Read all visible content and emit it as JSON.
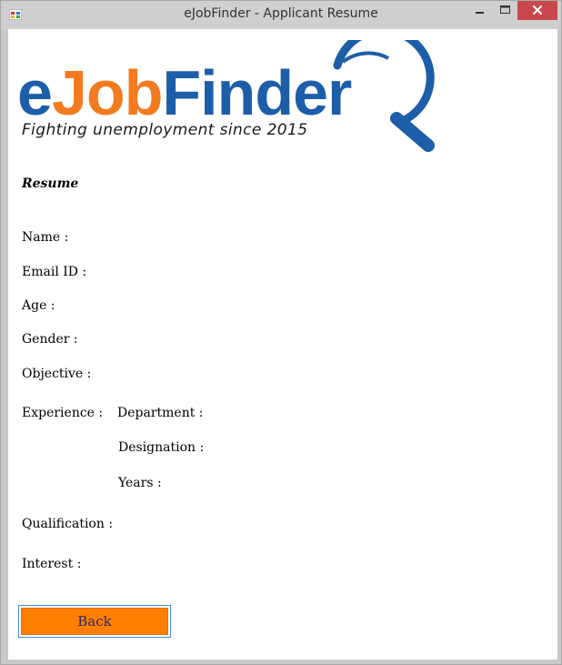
{
  "window": {
    "title": "eJobFinder - Applicant Resume"
  },
  "brand": {
    "logo_prefix": "e",
    "logo_mid": "Job",
    "logo_suffix": "Finder",
    "tagline": "Fighting unemployment since 2015",
    "color_blue": "#1d5ea8",
    "color_orange": "#f47a20"
  },
  "resume": {
    "heading": "Resume",
    "name_label": "Name :",
    "email_label": "Email ID :",
    "age_label": "Age :",
    "gender_label": "Gender :",
    "objective_label": "Objective :",
    "experience_label": "Experience :",
    "department_label": "Department :",
    "designation_label": "Designation :",
    "years_label": "Years :",
    "qualification_label": "Qualification :",
    "interest_label": "Interest :"
  },
  "actions": {
    "back_label": "Back",
    "back_color": "#ff7f00"
  }
}
